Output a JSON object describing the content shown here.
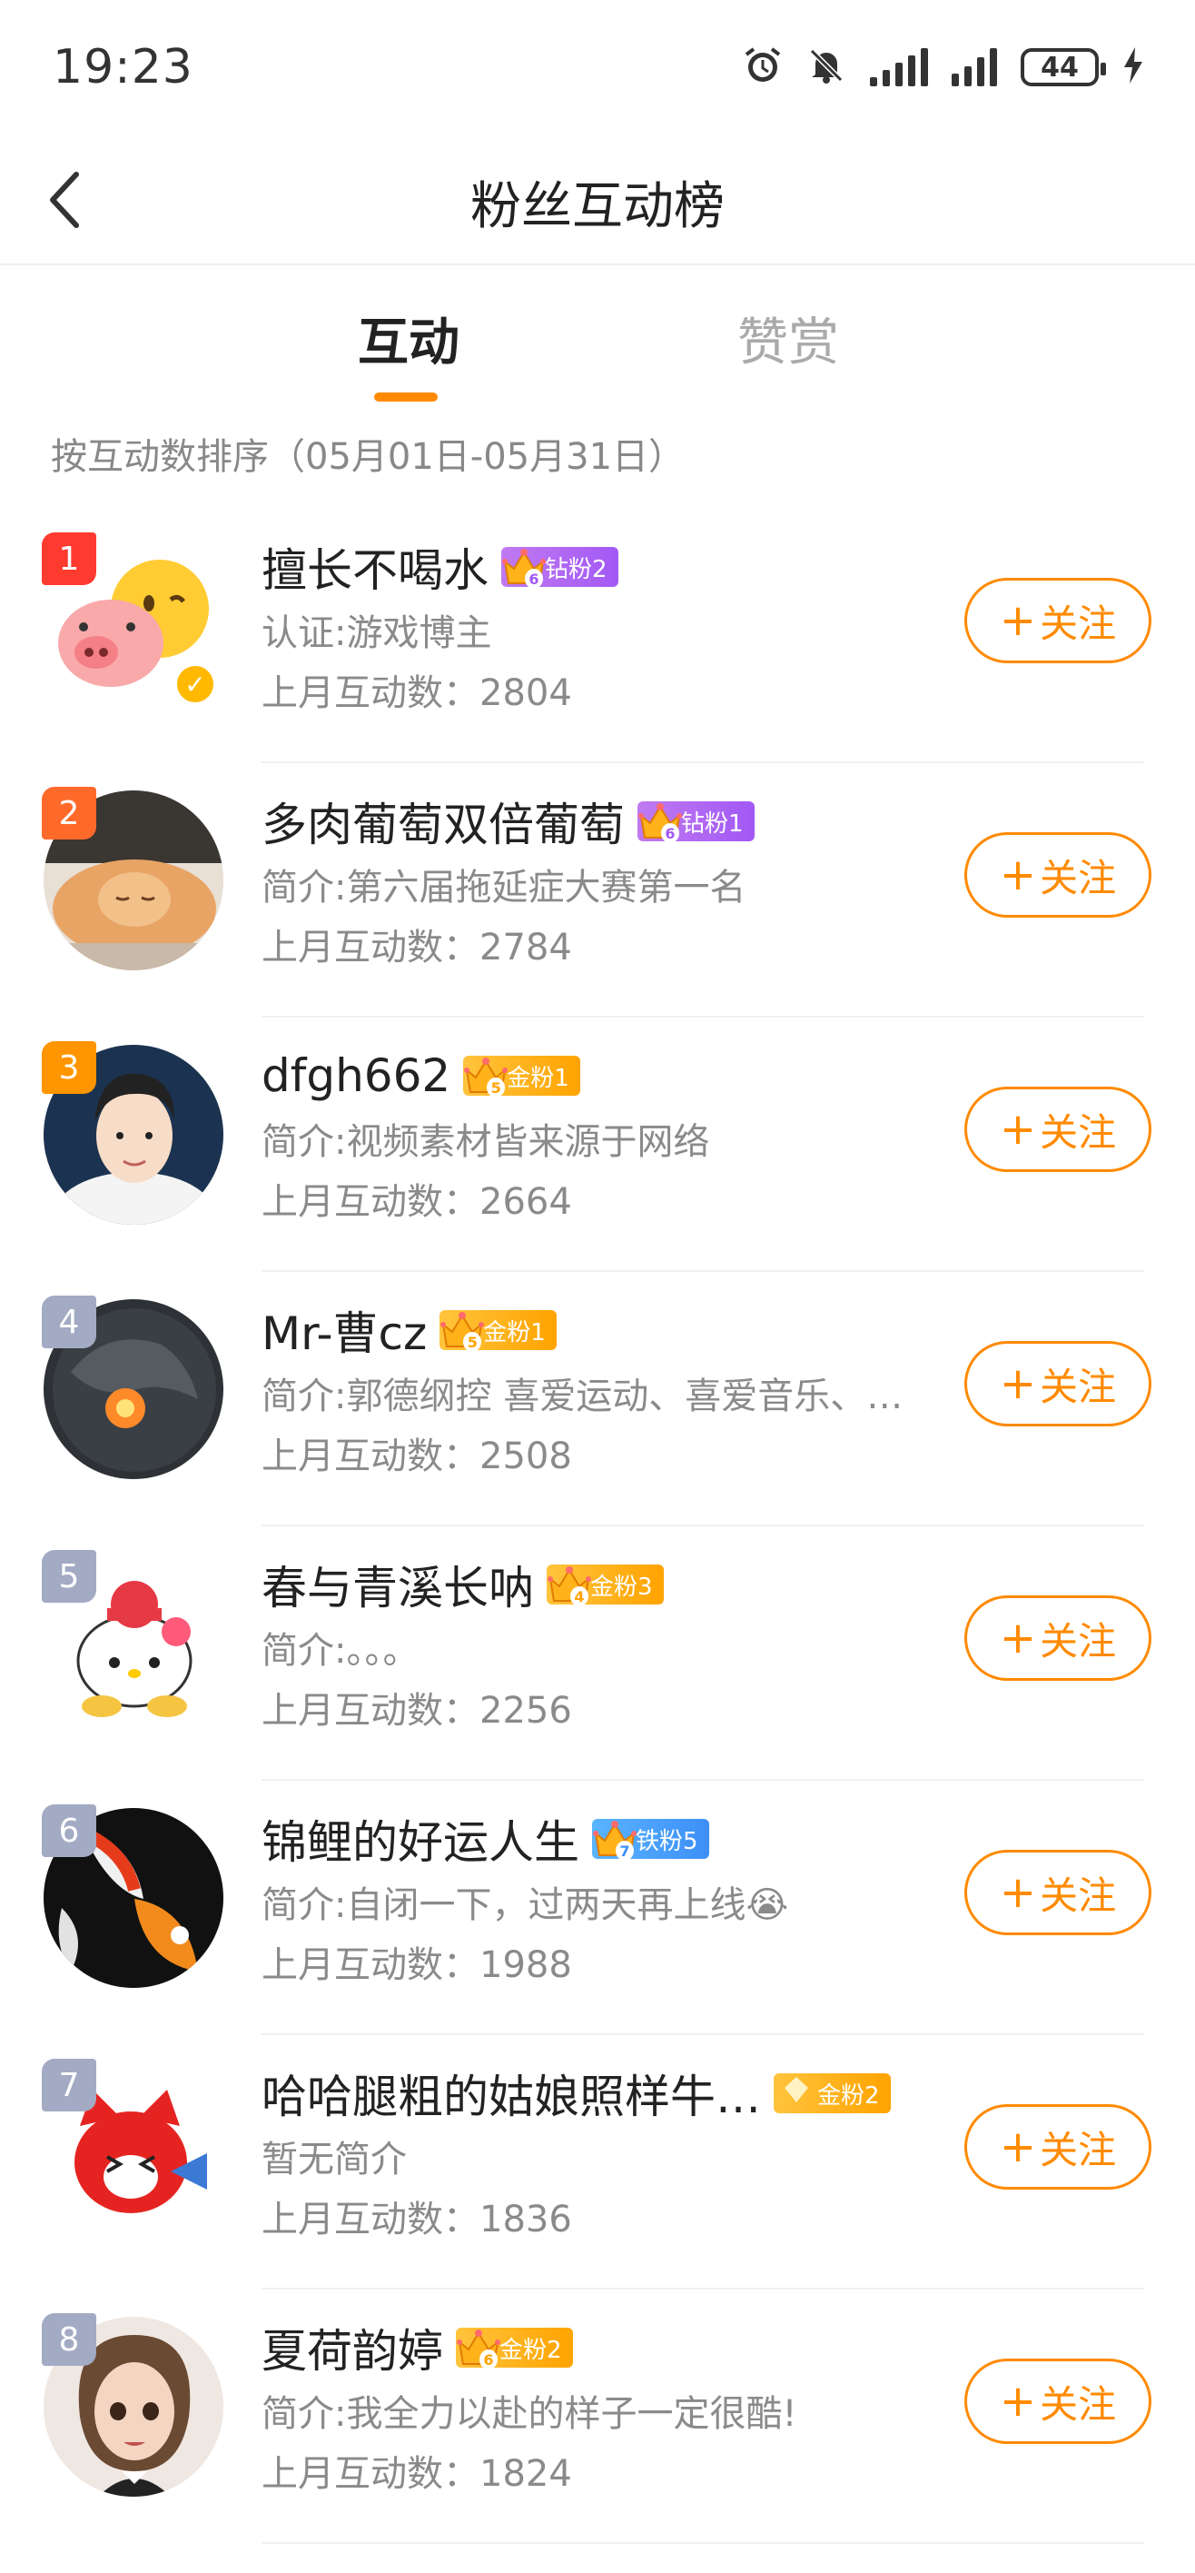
{
  "status_bar": {
    "time": "19:23",
    "battery": "44"
  },
  "nav": {
    "title": "粉丝互动榜"
  },
  "tabs": [
    {
      "label": "互动"
    },
    {
      "label": "赞赏"
    }
  ],
  "sort_label": "按互动数排序（05月01日-05月31日）",
  "follow_label": "关注",
  "fans": [
    {
      "rank": "1",
      "name": "擅长不喝水",
      "badge": "钻粉2",
      "badge_level": "6",
      "badge_type": "diamond",
      "desc": "认证:游戏博主",
      "count_label": "上月互动数：",
      "count": "2804",
      "rank_color": "#ff3b30",
      "avatar": "pig-kiss-avatar",
      "verified": true
    },
    {
      "rank": "2",
      "name": "多肉葡萄双倍葡萄",
      "badge": "钻粉1",
      "badge_level": "6",
      "badge_type": "diamond",
      "desc": "简介:第六届拖延症大赛第一名",
      "count_label": "上月互动数：",
      "count": "2784",
      "rank_color": "#ff6a2b",
      "avatar": "sleeping-cat-avatar"
    },
    {
      "rank": "3",
      "name": "dfgh662",
      "badge": "金粉1",
      "badge_level": "5",
      "badge_type": "gold",
      "desc": "简介:视频素材皆来源于网络",
      "count_label": "上月互动数：",
      "count": "2664",
      "rank_color": "#ff9500",
      "avatar": "person-avatar"
    },
    {
      "rank": "4",
      "name": "Mr-曹cz",
      "badge": "金粉1",
      "badge_level": "5",
      "badge_type": "gold",
      "desc": "简介:郭德纲控 喜爱运动、喜爱音乐、…",
      "count_label": "上月互动数：",
      "count": "2508",
      "rank_color": "#a3aac4",
      "avatar": "dragon-avatar"
    },
    {
      "rank": "5",
      "name": "春与青溪长呐",
      "badge": "金粉3",
      "badge_level": "4",
      "badge_type": "gold",
      "desc": "简介:。。。",
      "count_label": "上月互动数：",
      "count": "2256",
      "rank_color": "#a3aac4",
      "avatar": "hello-kitty-avatar"
    },
    {
      "rank": "6",
      "name": "锦鲤的好运人生",
      "badge": "铁粉5",
      "badge_level": "7",
      "badge_type": "iron",
      "desc": "简介:自闭一下，过两天再上线😭",
      "count_label": "上月互动数：",
      "count": "1988",
      "rank_color": "#a3aac4",
      "avatar": "koi-avatar"
    },
    {
      "rank": "7",
      "name": "哈哈腿粗的姑娘照样牛…",
      "badge": "金粉2",
      "badge_level": "",
      "badge_type": "gold",
      "desc": "暂无简介",
      "count_label": "上月互动数：",
      "count": "1836",
      "rank_color": "#a3aac4",
      "avatar": "red-fox-avatar"
    },
    {
      "rank": "8",
      "name": "夏荷韵婷",
      "badge": "金粉2",
      "badge_level": "6",
      "badge_type": "gold",
      "desc": "简介:我全力以赴的样子一定很酷!",
      "count_label": "上月互动数：",
      "count": "1824",
      "rank_color": "#a3aac4",
      "avatar": "cartoon-girl-avatar"
    }
  ]
}
